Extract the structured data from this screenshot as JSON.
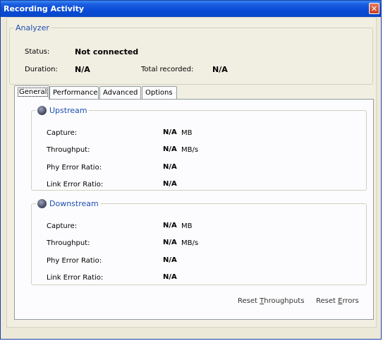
{
  "window": {
    "title": "Recording Activity",
    "close_glyph": "✕"
  },
  "analyzer": {
    "legend": "Analyzer",
    "status_label": "Status:",
    "status_value": "Not connected",
    "duration_label": "Duration:",
    "duration_value": "N/A",
    "total_label": "Total recorded:",
    "total_value": "N/A"
  },
  "tabs": [
    {
      "label": "General",
      "active": true
    },
    {
      "label": "Performance",
      "active": false
    },
    {
      "label": "Advanced",
      "active": false
    },
    {
      "label": "Options",
      "active": false
    }
  ],
  "upstream": {
    "legend": "Upstream",
    "icon": "upstream-ball-icon",
    "rows": [
      {
        "label": "Capture:",
        "value": "N/A",
        "unit": "MB"
      },
      {
        "label": "Throughput:",
        "value": "N/A",
        "unit": "MB/s"
      },
      {
        "label": "Phy Error Ratio:",
        "value": "N/A",
        "unit": ""
      },
      {
        "label": "Link Error Ratio:",
        "value": "N/A",
        "unit": ""
      }
    ]
  },
  "downstream": {
    "legend": "Downstream",
    "icon": "downstream-ball-icon",
    "rows": [
      {
        "label": "Capture:",
        "value": "N/A",
        "unit": "MB"
      },
      {
        "label": "Throughput:",
        "value": "N/A",
        "unit": "MB/s"
      },
      {
        "label": "Phy Error Ratio:",
        "value": "N/A",
        "unit": ""
      },
      {
        "label": "Link Error Ratio:",
        "value": "N/A",
        "unit": ""
      }
    ]
  },
  "actions": {
    "reset_throughputs_pre": "Reset ",
    "reset_throughputs_key": "T",
    "reset_throughputs_post": "hroughputs",
    "reset_errors_pre": "Reset ",
    "reset_errors_key": "E",
    "reset_errors_post": "rrors"
  }
}
